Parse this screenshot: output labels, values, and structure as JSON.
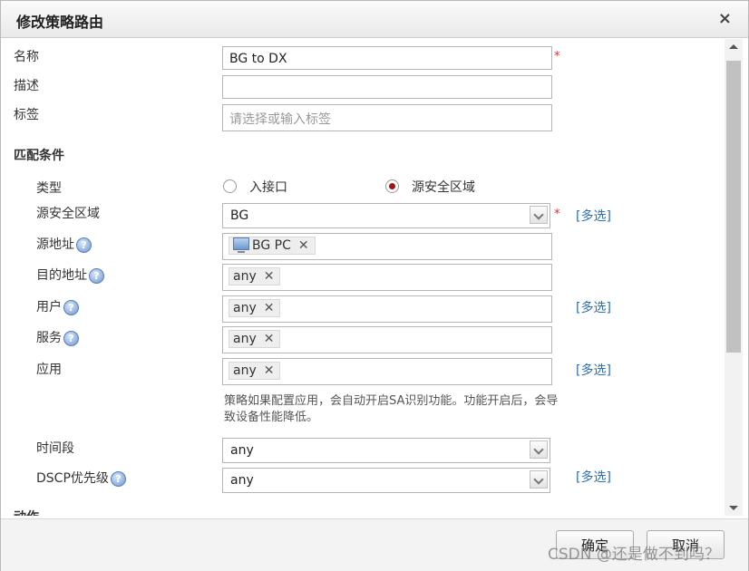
{
  "dialog": {
    "title": "修改策略路由",
    "close_glyph": "×"
  },
  "fields": {
    "name": {
      "label": "名称",
      "value": "BG to DX",
      "required": "*"
    },
    "desc": {
      "label": "描述",
      "value": ""
    },
    "tags": {
      "label": "标签",
      "placeholder": "请选择或输入标签"
    }
  },
  "match": {
    "section_title": "匹配条件",
    "type": {
      "label": "类型",
      "options": [
        "入接口",
        "源安全区域"
      ],
      "selected": "源安全区域"
    },
    "src_zone": {
      "label": "源安全区域",
      "value": "BG",
      "required": "*",
      "multi": "[多选]"
    },
    "src_addr": {
      "label": "源地址",
      "tag": "BG PC"
    },
    "dst_addr": {
      "label": "目的地址",
      "tag": "any"
    },
    "user": {
      "label": "用户",
      "tag": "any",
      "multi": "[多选]"
    },
    "service": {
      "label": "服务",
      "tag": "any"
    },
    "app": {
      "label": "应用",
      "tag": "any",
      "multi": "[多选]",
      "note": "策略如果配置应用，会自动开启SA识别功能。功能开启后，会导致设备性能降低。"
    },
    "time": {
      "label": "时间段",
      "value": "any"
    },
    "dscp": {
      "label": "DSCP优先级",
      "value": "any",
      "multi": "[多选]"
    }
  },
  "action": {
    "section_title": "动作"
  },
  "help_glyph": "?",
  "tag_close_glyph": "✕",
  "footer": {
    "ok": "确定",
    "cancel": "取消"
  },
  "watermark": "CSDN @还是做不到吗？",
  "colors": {
    "required": "#e03030",
    "link": "#2a6fb8",
    "radio_selected": "#a31414"
  }
}
